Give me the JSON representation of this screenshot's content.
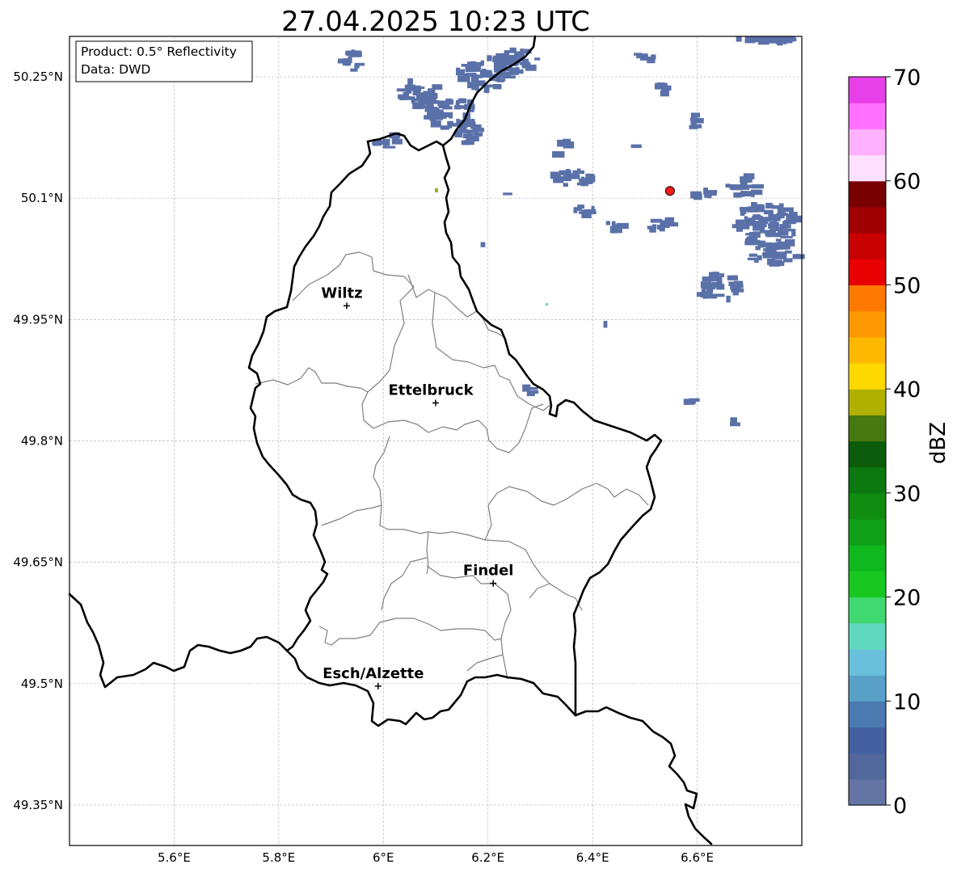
{
  "title": "27.04.2025 10:23 UTC",
  "info_box": {
    "product": "Product: 0.5° Reflectivity",
    "data": "Data: DWD"
  },
  "lat_ticks": [
    "50.25°N",
    "50.1°N",
    "49.95°N",
    "49.8°N",
    "49.65°N",
    "49.5°N",
    "49.35°N"
  ],
  "lon_ticks": [
    "5.6°E",
    "5.8°E",
    "6°E",
    "6.2°E",
    "6.4°E",
    "6.6°E"
  ],
  "cities": [
    {
      "name": "Wiltz",
      "lon": 5.93,
      "lat": 49.967
    },
    {
      "name": "Ettelbruck",
      "lon": 6.1,
      "lat": 49.847
    },
    {
      "name": "Findel",
      "lon": 6.21,
      "lat": 49.624
    },
    {
      "name": "Esch/Alzette",
      "lon": 5.99,
      "lat": 49.497
    }
  ],
  "radar_site": {
    "lon": 6.548,
    "lat": 50.109,
    "color": "#ff1a1a"
  },
  "map_extent": {
    "lon": [
      5.4,
      6.8
    ],
    "lat": [
      49.3,
      50.3
    ]
  },
  "colorbar": {
    "label": "dBZ",
    "tick_labels": [
      "0",
      "10",
      "20",
      "30",
      "40",
      "50",
      "60",
      "70"
    ],
    "min": 0,
    "max": 70,
    "colors": [
      "#6474a4",
      "#52689c",
      "#4460a0",
      "#4a7ab0",
      "#58a0c8",
      "#68c0dc",
      "#60d8c0",
      "#40d870",
      "#18c820",
      "#10b820",
      "#10a018",
      "#108c10",
      "#0c7810",
      "#0a5c0a",
      "#487810",
      "#b0b000",
      "#ffd800",
      "#ffb800",
      "#ff9800",
      "#ff7800",
      "#e80000",
      "#c80000",
      "#a00000",
      "#780000",
      "#ffe0ff",
      "#ffb0ff",
      "#ff70ff",
      "#e840e8"
    ]
  },
  "colors": {
    "echo": "#5a70a8",
    "border": "#000000",
    "canton": "#808080",
    "grid": "#b8b8b8"
  }
}
